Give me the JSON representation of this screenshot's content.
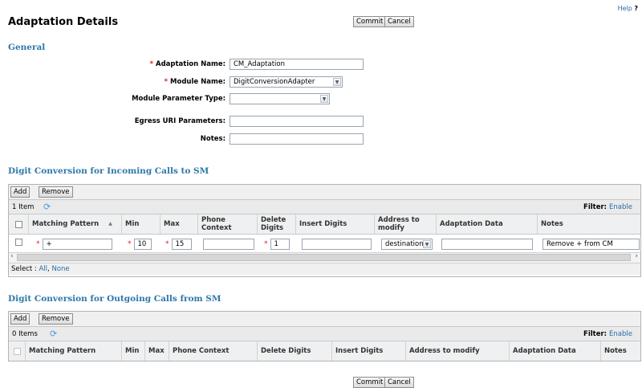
{
  "header": {
    "title": "Adaptation Details",
    "help": "Help",
    "help_mark": "?"
  },
  "actions": {
    "commit": "Commit",
    "cancel": "Cancel"
  },
  "general": {
    "section_title": "General",
    "adaptation_name": {
      "label": "Adaptation Name:",
      "value": "CM_Adaptation"
    },
    "module_name": {
      "label": "Module Name:",
      "value": "DigitConversionAdapter"
    },
    "module_param_type": {
      "label": "Module Parameter Type:",
      "value": ""
    },
    "egress_uri": {
      "label": "Egress URI Parameters:",
      "value": ""
    },
    "notes": {
      "label": "Notes:",
      "value": ""
    },
    "required_mark": "*"
  },
  "incoming": {
    "section_title": "Digit Conversion for Incoming Calls to SM",
    "add": "Add",
    "remove": "Remove",
    "count": "1 Item",
    "filter_label": "Filter:",
    "filter_link": "Enable",
    "columns": [
      "Matching Pattern",
      "Min",
      "Max",
      "Phone Context",
      "Delete Digits",
      "Insert Digits",
      "Address to modify",
      "Adaptation Data",
      "Notes"
    ],
    "row": {
      "pattern": "+",
      "min": "10",
      "max": "15",
      "phone_context": "",
      "delete_digits": "1",
      "insert_digits": "",
      "address": "destination",
      "adaptation_data": "",
      "notes": "Remove + from CM"
    },
    "select_label": "Select :",
    "select_all": "All",
    "select_none": "None"
  },
  "outgoing": {
    "section_title": "Digit Conversion for Outgoing Calls from SM",
    "add": "Add",
    "remove": "Remove",
    "count": "0 Items",
    "filter_label": "Filter:",
    "filter_link": "Enable",
    "columns": [
      "Matching Pattern",
      "Min",
      "Max",
      "Phone Context",
      "Delete Digits",
      "Insert Digits",
      "Address to modify",
      "Adaptation Data",
      "Notes"
    ]
  }
}
